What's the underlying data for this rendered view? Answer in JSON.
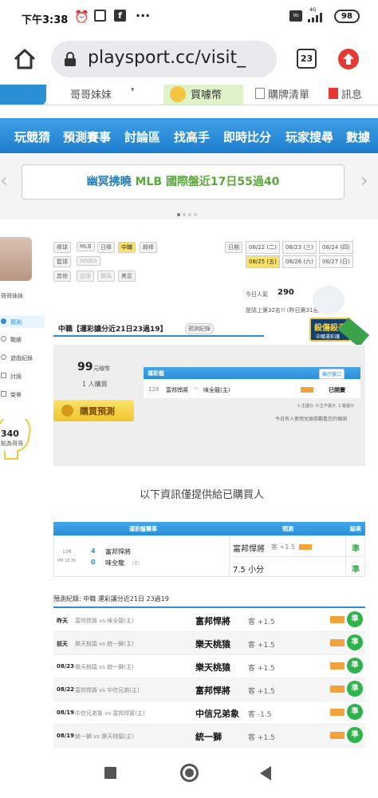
{
  "status": {
    "time": "下午3:38",
    "battery": "98",
    "signal": "4G"
  },
  "browser": {
    "url": "playsport.cc/visit_",
    "tab_count": "23"
  },
  "top_nav": {
    "item1": "哥哥妹妹",
    "item2": "買噱幣",
    "item3": "購牌清單",
    "item4": "訊息"
  },
  "main_nav": [
    "玩競猜",
    "預測賽事",
    "討論區",
    "找高手",
    "即時比分",
    "玩家搜尋",
    "數據"
  ],
  "banner": {
    "text_prefix": "幽冥拂曉",
    "text_highlight": "MLB 國際盤近17日55過40"
  },
  "sports": {
    "rows": [
      {
        "label": "棒球",
        "items": [
          "MLB",
          "日棒",
          "中職",
          "韓棒"
        ]
      },
      {
        "label": "籃球",
        "items": [
          "WNBA"
        ]
      },
      {
        "label": "其他",
        "items": [
          "足球",
          "賽馬",
          "美足"
        ]
      }
    ]
  },
  "dates": {
    "label": "日期",
    "items": [
      "08/22 (二)",
      "08/23 (三)",
      "08/24 (四)",
      "08/25 (五)",
      "08/26 (六)",
      "08/27 (日)"
    ]
  },
  "popularity": {
    "label": "今日人氣",
    "value": "290",
    "rank": "是誌上第32名!! (昨日第31名)"
  },
  "profile": {
    "name": "哥哥妹妹"
  },
  "sidebar": {
    "items": [
      "預測",
      "戰績",
      "遊戲紀錄",
      "討論",
      "榮譽"
    ],
    "points": "340",
    "points_sub": "點為哥哥"
  },
  "section": {
    "title": "中職【運彩讓分近21日23過19】",
    "record_button": "預測紀錄",
    "badge": "殺傷殺手",
    "badge_sub": "中職運彩讓",
    "price": "99",
    "price_unit": "元噱幣",
    "buyers": "1 人購買",
    "buy_button": "購買預測"
  },
  "preview": {
    "header": "運彩盤",
    "show_button": "顯示盤口",
    "game_no": "128",
    "home": "富邦悍將",
    "away": "味全龍(主)",
    "status": "已開賽",
    "note1": "1:主讓分, 0:主不讓分, 1:客讓分",
    "note2": "今日有人使用兌換券觀看您的預測"
  },
  "info_text": "以下資訊僅提供給已購買人",
  "result_table": {
    "col1": "運彩盤賽事",
    "col2": "預測",
    "col3": "結果",
    "game_no": "128",
    "game_time": "PM 18:35",
    "team1_score": "4",
    "team1": "富邦悍將",
    "team2_score": "0",
    "team2": "味全龍",
    "team2_tag": "(主)",
    "pick1": "富邦悍將",
    "pick1_odds": "客 +1.5",
    "pick1_result": "準",
    "pick2": "7.5 小分",
    "pick2_result": "準"
  },
  "history": {
    "caption": "預測紀錄: 中職 運彩讓分近21日 23過19",
    "rows": [
      {
        "when": "昨天",
        "match": "富邦悍將 vs 味全龍(主)",
        "pick": "富邦悍將",
        "odds": "客 +1.5",
        "result": "準"
      },
      {
        "when": "前天",
        "match": "樂天桃猿 vs 統一獅(主)",
        "pick": "樂天桃猿",
        "odds": "客 +1.5",
        "result": "準"
      },
      {
        "when": "08/23",
        "match": "樂天桃猿 vs 統一獅(主)",
        "pick": "樂天桃猿",
        "odds": "客 +1.5",
        "result": "準"
      },
      {
        "when": "08/22",
        "match": "富邦悍將 vs 中信兄弟(主)",
        "pick": "富邦悍將",
        "odds": "客 +1.5",
        "result": "準"
      },
      {
        "when": "08/19",
        "match": "中信兄弟象 vs 富邦悍將(主)",
        "pick": "中信兄弟象",
        "odds": "客 -1.5",
        "result": "準"
      },
      {
        "when": "08/19",
        "match": "統一獅 vs 樂天桃猿(主)",
        "pick": "統一獅",
        "odds": "客 +1.5",
        "result": "準"
      }
    ]
  }
}
